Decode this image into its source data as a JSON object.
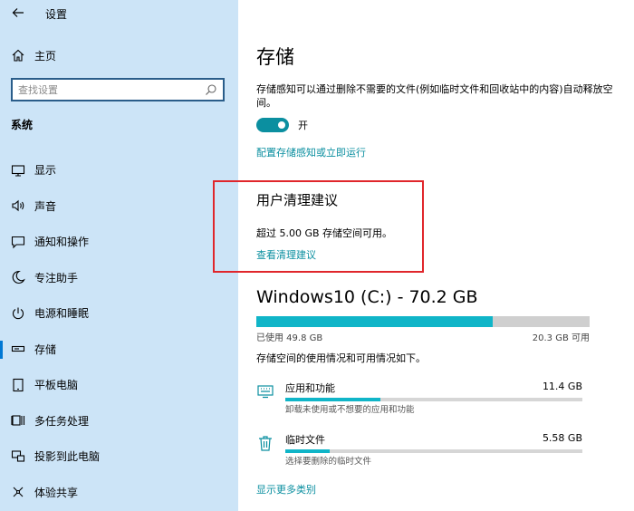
{
  "window": {
    "title": "设置"
  },
  "sidebar": {
    "home_label": "主页",
    "search_placeholder": "查找设置",
    "section_label": "系统",
    "items": [
      {
        "label": "显示",
        "icon": "display-icon"
      },
      {
        "label": "声音",
        "icon": "sound-icon"
      },
      {
        "label": "通知和操作",
        "icon": "notification-icon"
      },
      {
        "label": "专注助手",
        "icon": "moon-icon"
      },
      {
        "label": "电源和睡眠",
        "icon": "power-icon"
      },
      {
        "label": "存储",
        "icon": "storage-icon",
        "active": true
      },
      {
        "label": "平板电脑",
        "icon": "tablet-icon"
      },
      {
        "label": "多任务处理",
        "icon": "multitask-icon"
      },
      {
        "label": "投影到此电脑",
        "icon": "project-icon"
      },
      {
        "label": "体验共享",
        "icon": "share-icon"
      }
    ]
  },
  "main": {
    "title": "存储",
    "sense_desc": "存储感知可以通过删除不需要的文件(例如临时文件和回收站中的内容)自动释放空间。",
    "toggle_label": "开",
    "config_link": "配置存储感知或立即运行",
    "suggest": {
      "title": "用户清理建议",
      "text": "超过 5.00 GB 存储空间可用。",
      "link": "查看清理建议"
    },
    "drive": {
      "title": "Windows10 (C:) - 70.2 GB",
      "used_label": "已使用 49.8 GB",
      "free_label": "20.3 GB 可用",
      "used_fraction": 0.71,
      "usage_desc": "存储空间的使用情况和可用情况如下。"
    },
    "categories": [
      {
        "name": "应用和功能",
        "size": "11.4 GB",
        "sub": "卸载未使用或不想要的应用和功能",
        "fraction": 0.32,
        "icon": "apps-icon"
      },
      {
        "name": "临时文件",
        "size": "5.58 GB",
        "sub": "选择要删除的临时文件",
        "fraction": 0.15,
        "icon": "trash-icon"
      }
    ],
    "more_link": "显示更多类别"
  },
  "colors": {
    "accent": "#0b8fa0",
    "bar": "#10b5c8",
    "sidebar_bg": "#cce4f7",
    "highlight": "#e0262b"
  }
}
